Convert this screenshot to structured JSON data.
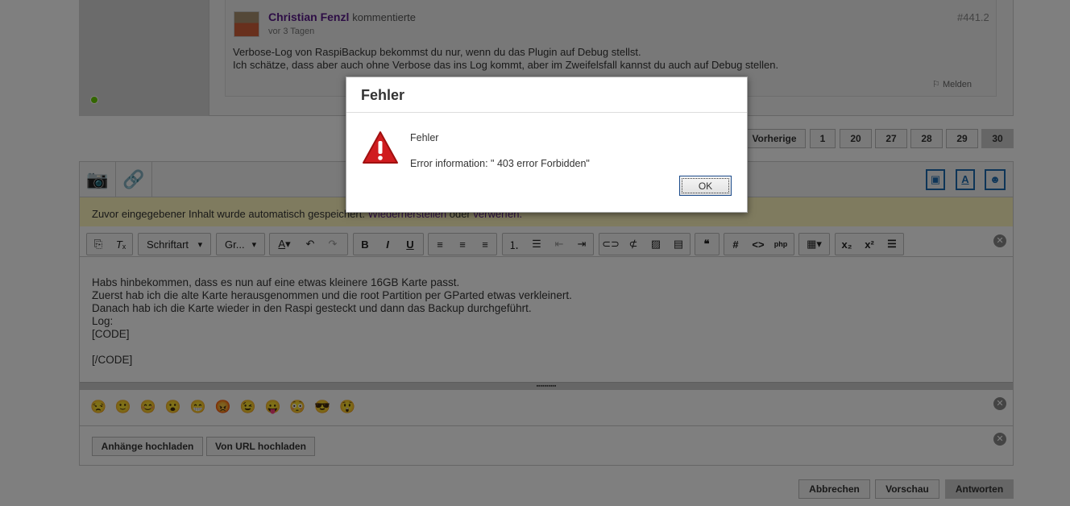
{
  "comment": {
    "author": "Christian Fenzl",
    "action": "kommentierte",
    "time": "vor 3 Tagen",
    "id": "#441.2",
    "lines": [
      "Verbose-Log von RaspiBackup bekommst du nur, wenn du das Plugin auf Debug stellst.",
      "Ich schätze, dass aber auch ohne Verbose das ins Log kommt, aber im Zweifelsfall kannst du auch auf Debug stellen."
    ],
    "report": "Melden"
  },
  "pagination": {
    "prev": "Vorherige",
    "pages": [
      "1",
      "20",
      "27",
      "28",
      "29",
      "30"
    ],
    "current": "30"
  },
  "autosave": {
    "text": "Zuvor eingegebener Inhalt wurde automatisch gespeichert.",
    "restore": "Wiederherstellen",
    "or": "oder",
    "discard": "verwerfen."
  },
  "toolbar": {
    "font": "Schriftart",
    "size": "Gr..."
  },
  "editor": {
    "lines": [
      "Habs hinbekommen, dass es nun auf eine etwas kleinere 16GB Karte passt.",
      "Zuerst hab ich die alte Karte herausgenommen und die root Partition per GParted etwas verkleinert.",
      "Danach hab ich die Karte wieder in den Raspi gesteckt und dann das Backup durchgeführt.",
      "Log:",
      "[CODE]",
      "",
      "[/CODE]"
    ]
  },
  "smileys": [
    "😒",
    "🙂",
    "😊",
    "😮",
    "😁",
    "😡",
    "😉",
    "😛",
    "😳",
    "😎",
    "😲"
  ],
  "attachments": {
    "upload": "Anhänge hochladen",
    "url": "Von URL hochladen"
  },
  "actions": {
    "cancel": "Abbrechen",
    "preview": "Vorschau",
    "reply": "Antworten"
  },
  "dialog": {
    "title": "Fehler",
    "heading": "Fehler",
    "message": "Error information: \" 403 error Forbidden\"",
    "ok": "OK"
  }
}
